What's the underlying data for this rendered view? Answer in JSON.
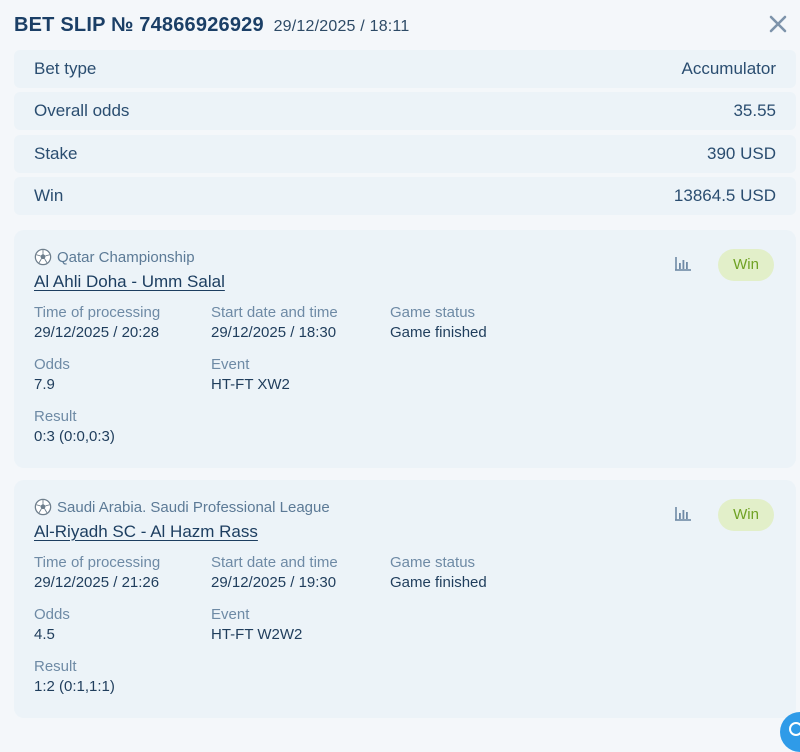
{
  "header": {
    "title": "BET SLIP № 74866926929",
    "datetime": "29/12/2025 / 18:11"
  },
  "summary": [
    {
      "label": "Bet type",
      "value": "Accumulator"
    },
    {
      "label": "Overall odds",
      "value": "35.55"
    },
    {
      "label": "Stake",
      "value": "390 USD"
    },
    {
      "label": "Win",
      "value": "13864.5 USD"
    }
  ],
  "labels": {
    "time_of_processing": "Time of processing",
    "start_date": "Start date and time",
    "game_status": "Game status",
    "odds": "Odds",
    "event": "Event",
    "result": "Result"
  },
  "bets": [
    {
      "league": "Qatar Championship",
      "match": "Al Ahli Doha - Umm Salal",
      "status_badge": "Win",
      "processing_time": "29/12/2025 / 20:28",
      "start_time": "29/12/2025 / 18:30",
      "game_status": "Game finished",
      "odds": "7.9",
      "event": "HT-FT XW2",
      "result": "0:3 (0:0,0:3)"
    },
    {
      "league": "Saudi Arabia. Saudi Professional League",
      "match": "Al-Riyadh SC - Al Hazm Rass",
      "status_badge": "Win",
      "processing_time": "29/12/2025 / 21:26",
      "start_time": "29/12/2025 / 19:30",
      "game_status": "Game finished",
      "odds": "4.5",
      "event": "HT-FT W2W2",
      "result": "1:2 (0:1,1:1)"
    }
  ],
  "colors": {
    "background": "#f4f7fa",
    "panel": "#ecf3f8",
    "title": "#1b3f66",
    "win_badge_bg": "#e2efc9",
    "win_badge_text": "#6fa224"
  }
}
